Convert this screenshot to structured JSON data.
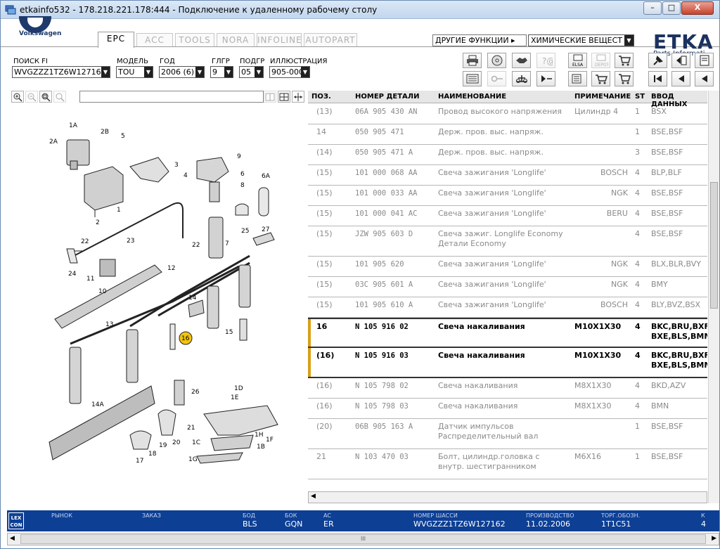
{
  "window": {
    "title": "etkainfo532 - 178.218.221.178:444 - Подключение к удаленному рабочему столу",
    "min_label": "–",
    "max_label": "□",
    "close_label": "X"
  },
  "brand": {
    "vw_label": "Volkswagen",
    "etka_label": "ETKA",
    "etka_sub": "Parts Informati"
  },
  "tabs": [
    {
      "label": "EPC",
      "active": true
    },
    {
      "label": "ACC"
    },
    {
      "label": "TOOLS"
    },
    {
      "label": "NORA"
    },
    {
      "label": "INFOLINE"
    },
    {
      "label": "AUTOPART"
    }
  ],
  "functions": {
    "other_label": "ДРУГИЕ ФУНКЦИИ ▸",
    "chem_value": "ХИМИЧЕСКИЕ ВЕЩЕСТ"
  },
  "selectors": {
    "fi": {
      "label": "ПОИСК FI",
      "value": "WVGZZZ1TZ6W12716"
    },
    "model": {
      "label": "МОДЕЛЬ",
      "value": "TOU"
    },
    "year": {
      "label": "ГОД",
      "value": "2006 (6)"
    },
    "glgr": {
      "label": "ГЛГР",
      "value": "9"
    },
    "podgr": {
      "label": "ПОДГР",
      "value": "05"
    },
    "illust": {
      "label": "ИЛЛЮСТРАЦИЯ",
      "value": "905-000"
    }
  },
  "table": {
    "headers": {
      "pos": "ПОЗ.",
      "part": "НОМЕР ДЕТАЛИ",
      "name": "НАИМЕНОВАНИЕ",
      "note": "ПРИМЕЧАНИЕ",
      "st": "ST",
      "input": "ВВОД ДАННЫХ"
    },
    "rows": [
      {
        "pos": "(13)",
        "part": "06A 905 430 AN",
        "name": "Провод высокого напряжения",
        "name2": "",
        "note": "Цилиндр 4",
        "st": "1",
        "input": "BSX",
        "input2": ""
      },
      {
        "pos": "14",
        "part": "050 905 471",
        "name": "Держ. пров. выс. напряж.",
        "name2": "",
        "note": "",
        "st": "1",
        "input": "BSE,BSF",
        "input2": ""
      },
      {
        "pos": "(14)",
        "part": "050 905 471 A",
        "name": "Держ. пров. выс. напряж.",
        "name2": "",
        "note": "",
        "st": "3",
        "input": "BSE,BSF",
        "input2": ""
      },
      {
        "pos": "(15)",
        "part": "101 000 068 AA",
        "name": "Свеча зажигания 'Longlife'",
        "name2": "",
        "note": "BOSCH",
        "st": "4",
        "input": "BLP,BLF",
        "input2": ""
      },
      {
        "pos": "(15)",
        "part": "101 000 033 AA",
        "name": "Свеча зажигания 'Longlife'",
        "name2": "",
        "note": "NGK",
        "st": "4",
        "input": "BSE,BSF",
        "input2": ""
      },
      {
        "pos": "(15)",
        "part": "101 000 041 AC",
        "name": "Свеча зажигания 'Longlife'",
        "name2": "",
        "note": "BERU",
        "st": "4",
        "input": "BSE,BSF",
        "input2": ""
      },
      {
        "pos": "(15)",
        "part": "JZW 905 603 D",
        "name": "Свеча зажиг. Longlife  Economy",
        "name2": "Детали Economy",
        "note": "",
        "st": "4",
        "input": "BSE,BSF",
        "input2": ""
      },
      {
        "pos": "(15)",
        "part": "101 905 620",
        "name": "Свеча зажигания 'Longlife'",
        "name2": "",
        "note": "NGK",
        "st": "4",
        "input": "BLX,BLR,BVY",
        "input2": ""
      },
      {
        "pos": "(15)",
        "part": "03C 905 601 A",
        "name": "Свеча зажигания 'Longlife'",
        "name2": "",
        "note": "NGK",
        "st": "4",
        "input": "BMY",
        "input2": ""
      },
      {
        "pos": "(15)",
        "part": "101 905 610 A",
        "name": "Свеча зажигания 'Longlife'",
        "name2": "",
        "note": "BOSCH",
        "st": "4",
        "input": "BLY,BVZ,BSX",
        "input2": ""
      },
      {
        "pos": "16",
        "part": "N   105 916 02",
        "name": "Свеча накаливания",
        "name2": "",
        "note": "M10X1X30",
        "st": "4",
        "input": "BKC,BRU,BXF,",
        "input2": "BXE,BLS,BMM",
        "selected": true
      },
      {
        "pos": "(16)",
        "part": "N   105 916 03",
        "name": "Свеча накаливания",
        "name2": "",
        "note": "M10X1X30",
        "st": "4",
        "input": "BKC,BRU,BXF,",
        "input2": "BXE,BLS,BMM",
        "selected": true
      },
      {
        "pos": "(16)",
        "part": "N   105 798 02",
        "name": "Свеча накаливания",
        "name2": "",
        "note": "M8X1X30",
        "st": "4",
        "input": "BKD,AZV",
        "input2": ""
      },
      {
        "pos": "(16)",
        "part": "N   105 798 03",
        "name": "Свеча накаливания",
        "name2": "",
        "note": "M8X1X30",
        "st": "4",
        "input": "BMN",
        "input2": ""
      },
      {
        "pos": "(20)",
        "part": "06B 905 163 A",
        "name": "Датчик импульсов",
        "name2": "Распределительный вал",
        "note": "",
        "st": "1",
        "input": "BSE,BSF",
        "input2": ""
      },
      {
        "pos": "21",
        "part": "N   103 470 03",
        "name": "Болт, цилиндр.головка с",
        "name2": "внутр. шестигранником",
        "note": "M6X16",
        "st": "1",
        "input": "BSE,BSF",
        "input2": ""
      }
    ]
  },
  "diagram": {
    "labels": [
      "1A",
      "2B",
      "2A",
      "5",
      "3",
      "4",
      "9",
      "6",
      "8",
      "6A",
      "2",
      "1",
      "23",
      "22",
      "22",
      "7",
      "25",
      "27",
      "24",
      "11",
      "10",
      "12",
      "14",
      "15",
      "13",
      "16",
      "26",
      "1D",
      "1E",
      "14A",
      "21",
      "20",
      "19",
      "18",
      "17",
      "1C",
      "1H",
      "1F",
      "1B",
      "1G"
    ]
  },
  "status": {
    "lexcon": "LEX CON",
    "market_label": "РЫНОК",
    "order_label": "ЗАКАЗ",
    "bod_label": "БОД",
    "bod_value": "BLS",
    "bok_label": "БОК",
    "bok_value": "GQN",
    "ac_label": "AC",
    "ac_value": "ER",
    "chassis_label": "НОМЕР ШАССИ",
    "chassis_value": "WVGZZZ1TZ6W127162",
    "prod_label": "ПРОИЗВОДСТВО",
    "prod_value": "11.02.2006",
    "trade_label": "ТОРГ.ОБОЗН.",
    "trade_value": "1T1C51",
    "k_label": "К",
    "k_value": "4"
  },
  "scroll": {
    "grip": "III"
  }
}
